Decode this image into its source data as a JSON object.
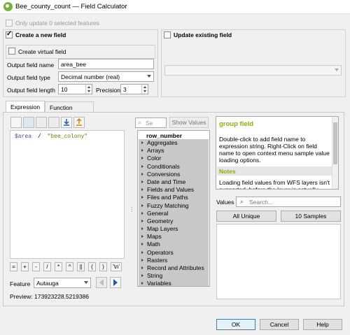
{
  "window": {
    "title": "Bee_county_count — Field Calculator"
  },
  "top": {
    "only_update_label": "Only update 0 selected features"
  },
  "create_new": {
    "label": "Create a new field",
    "virtual_label": "Create virtual field",
    "name_label": "Output field name",
    "name_value": "area_bee",
    "type_label": "Output field type",
    "type_value": "Decimal number (real)",
    "length_label": "Output field length",
    "length_value": "10",
    "precision_label": "Precision",
    "precision_value": "3"
  },
  "update_existing": {
    "label": "Update existing field",
    "value": ""
  },
  "tabs": [
    {
      "label": "Expression",
      "active": true
    },
    {
      "label": "Function Editor",
      "active": false
    }
  ],
  "toolbar": {
    "icons": [
      "new-file-icon",
      "save-icon",
      "edit-icon",
      "delete-icon",
      "import-icon",
      "export-icon"
    ]
  },
  "expression": {
    "field": "$area",
    "operator": "/",
    "string": "\"bee_colony\""
  },
  "operators": [
    "=",
    "+",
    "-",
    "/",
    "*",
    "^",
    "||",
    "(",
    ")",
    "'\\n'"
  ],
  "feature": {
    "label": "Feature",
    "value": "Autauga"
  },
  "preview": {
    "label": "Preview:",
    "value": "173923228.5219386"
  },
  "search": {
    "placeholder": "Se",
    "show_values_label": "Show Values"
  },
  "function_tree": {
    "header": "row_number",
    "items": [
      "Aggregates",
      "Arrays",
      "Color",
      "Conditionals",
      "Conversions",
      "Date and Time",
      "Fields and Values",
      "Files and Paths",
      "Fuzzy Matching",
      "General",
      "Geometry",
      "Map Layers",
      "Maps",
      "Math",
      "Operators",
      "Rasters",
      "Record and Attributes",
      "String",
      "Variables"
    ]
  },
  "help": {
    "title": "group field",
    "body": "Double-click to add field name to expression string. Right-Click on field name to open context menu sample value loading options.",
    "notes_header": "Notes",
    "notes": "Loading field values from WFS layers isn't supported, before the layer is actually"
  },
  "values": {
    "label": "Values",
    "search_placeholder": "Search...",
    "all_unique_label": "All Unique",
    "samples_label": "10 Samples"
  },
  "dialog_buttons": {
    "ok": "OK",
    "cancel": "Cancel",
    "help": "Help"
  }
}
